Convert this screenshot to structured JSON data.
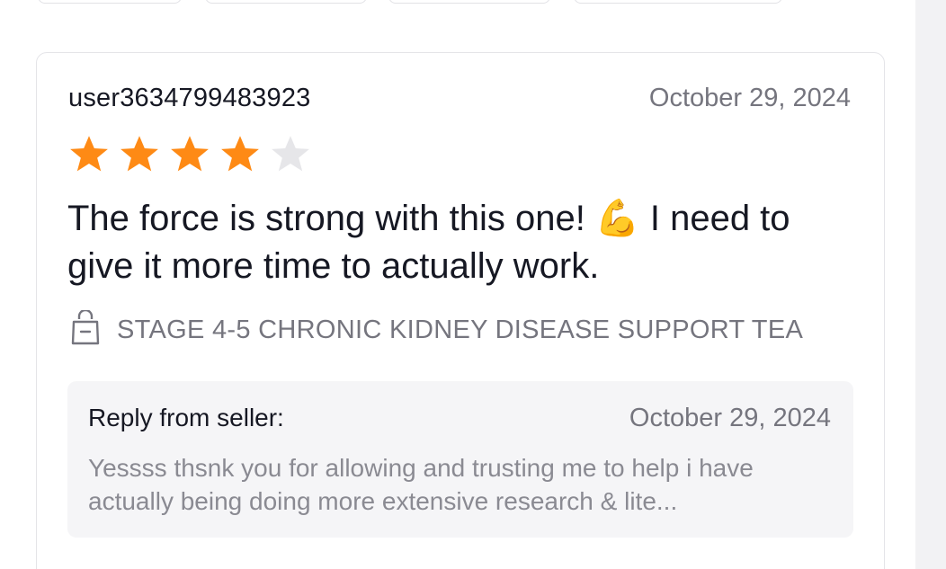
{
  "review": {
    "username": "user3634799483923",
    "date": "October 29, 2024",
    "rating": 4,
    "max_rating": 5,
    "text": "The force is strong with this one! 💪 I need to give it more time to actually work.",
    "product_icon": "shopping-bag-icon",
    "product_name": "STAGE 4-5 CHRONIC KIDNEY DISEASE SUPPORT TEA"
  },
  "seller_reply": {
    "label": "Reply from seller:",
    "date": "October 29, 2024",
    "text": "Yessss thsnk you for allowing and trusting me to help i have actually being doing more extensive research & lite..."
  },
  "colors": {
    "star_filled": "#fe8a15",
    "star_empty": "#e6e6e9",
    "text_primary": "#161823",
    "text_secondary": "#75757e",
    "reply_bg": "#f5f5f7"
  }
}
